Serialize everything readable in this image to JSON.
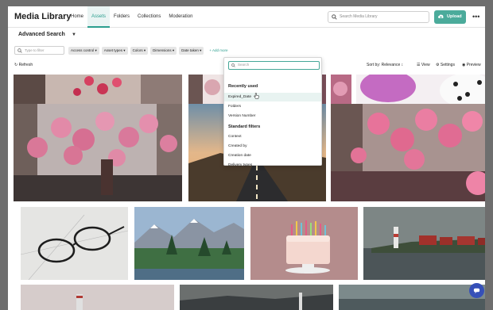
{
  "header": {
    "title": "Media Library",
    "nav": [
      "Home",
      "Assets",
      "Folders",
      "Collections",
      "Moderation"
    ],
    "active_nav": "Assets",
    "search_placeholder": "Search Media Library",
    "upload_label": "Upload",
    "more_label": "•••"
  },
  "subheader": {
    "title": "Advanced Search",
    "filter_placeholder": "Type to filter",
    "chips": [
      "Access control ▾",
      "Asset types ▾",
      "Colors ▾",
      "Dimensions ▾",
      "Date taken ▾"
    ],
    "add_more": "+ Add more"
  },
  "toolbar": {
    "refresh": "Refresh",
    "sort": "Sort by: Relevance",
    "view": "View",
    "settings": "Settings",
    "preview": "Preview"
  },
  "dropdown": {
    "search_placeholder": "Search",
    "recent_header": "Recently used",
    "recent_items": [
      "Expired_Date",
      "Folders",
      "Version Number"
    ],
    "standard_header": "Standard filters",
    "standard_items": [
      "Context",
      "Created by",
      "Creation date",
      "Delivery types"
    ]
  },
  "images": [
    "pink balloons cityscape",
    "pink balloons",
    "pink balloons",
    "pink dotted balloons",
    "pink balloons crowd street",
    "highway at sunset",
    "pink balloons crowd",
    "glasses on blueprint",
    "mountain lake",
    "birthday cake with candles",
    "lighthouse coastal village",
    "lighthouse",
    "dark coastline",
    "lighthouse"
  ],
  "colors": {
    "accent": "#2a9e8e",
    "upload": "#4bab9b",
    "help": "#3650b8"
  }
}
